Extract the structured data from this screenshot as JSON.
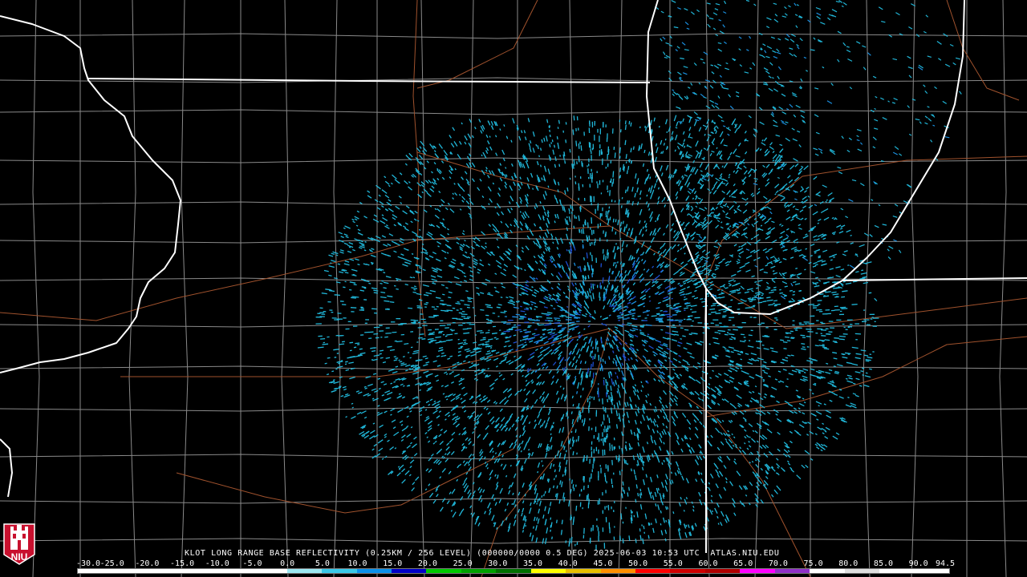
{
  "product": {
    "title": "KLOT LONG RANGE BASE REFLECTIVITY (0.25KM / 256 LEVEL) (000000/0000 0.5 DEG) 2025-06-03 10:53 UTC  ATLAS.NIU.EDU"
  },
  "legend": {
    "tick_labels": [
      "-30.0",
      "-25.0",
      "-20.0",
      "-15.0",
      "-10.0",
      "-5.0",
      "0.0",
      "5.0",
      "10.0",
      "15.0",
      "20.0",
      "25.0",
      "30.0",
      "35.0",
      "40.0",
      "45.0",
      "50.0",
      "55.0",
      "60.0",
      "65.0",
      "70.0",
      "75.0",
      "80.0",
      "85.0",
      "90.0",
      "94.5"
    ],
    "tick_values": [
      -30,
      -25,
      -20,
      -15,
      -10,
      -5,
      0,
      5,
      10,
      15,
      20,
      25,
      30,
      35,
      40,
      45,
      50,
      55,
      60,
      65,
      70,
      75,
      80,
      85,
      90,
      94.5
    ],
    "range": [
      -30,
      94.5
    ],
    "colors": [
      "#ffffff",
      "#ffffff",
      "#ffffff",
      "#ffffff",
      "#ffffff",
      "#ffffff",
      "#9de8f2",
      "#39c8e8",
      "#0a90ea",
      "#0000c8",
      "#00c800",
      "#00a000",
      "#007000",
      "#ffff00",
      "#e8c000",
      "#ff9000",
      "#ff0000",
      "#d00000",
      "#b00000",
      "#ff00ff",
      "#9030c8",
      "#ffffff",
      "#e0e0e0",
      "#ffffff",
      "#ffffff"
    ]
  },
  "logo": {
    "text": "NIU",
    "color": "#c8102e"
  },
  "colors": {
    "state_border": "#ffffff",
    "county_border": "#8a8a8a",
    "highway": "#a0522d",
    "echo_light": "#20b6d8",
    "echo_mid": "#1a8fe0",
    "echo_dark": "#1d4fd0"
  }
}
